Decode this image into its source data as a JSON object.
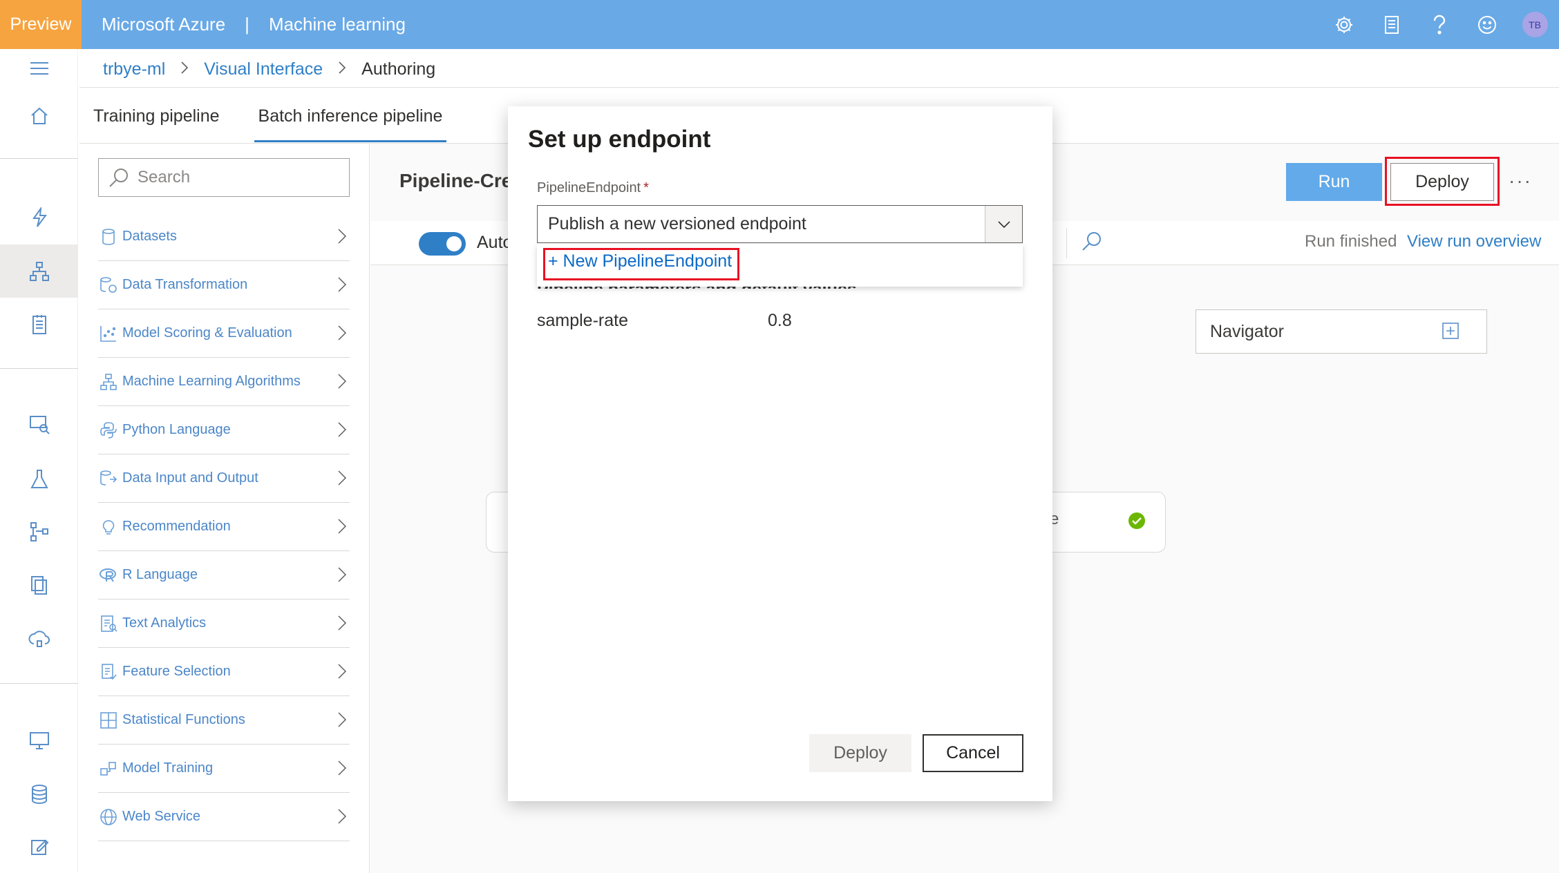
{
  "topbar": {
    "preview": "Preview",
    "product": "Microsoft Azure",
    "separator": "|",
    "service": "Machine learning",
    "avatar_initials": "TB",
    "icons": [
      "gear-icon",
      "notebook-icon",
      "help-icon",
      "smiley-icon"
    ],
    "colors": {
      "bar": "#69a9e6",
      "preview_badge": "#f6a440"
    }
  },
  "breadcrumb": {
    "items": [
      "trbye-ml",
      "Visual Interface",
      "Authoring"
    ]
  },
  "tabs": [
    {
      "label": "Training pipeline"
    },
    {
      "label": "Batch inference pipeline",
      "active": true
    }
  ],
  "palette": {
    "search_placeholder": "Search",
    "items": [
      {
        "label": "Datasets",
        "icon": "cylinder-icon"
      },
      {
        "label": "Data Transformation",
        "icon": "data-transform-icon"
      },
      {
        "label": "Model Scoring & Evaluation",
        "icon": "scatter-icon"
      },
      {
        "label": "Machine Learning Algorithms",
        "icon": "tree-icon"
      },
      {
        "label": "Python Language",
        "icon": "python-icon"
      },
      {
        "label": "Data Input and Output",
        "icon": "data-io-icon"
      },
      {
        "label": "Recommendation",
        "icon": "lightbulb-icon"
      },
      {
        "label": "R Language",
        "icon": "r-icon"
      },
      {
        "label": "Text Analytics",
        "icon": "text-analytics-icon"
      },
      {
        "label": "Feature Selection",
        "icon": "feature-select-icon"
      },
      {
        "label": "Statistical Functions",
        "icon": "grid-icon"
      },
      {
        "label": "Model Training",
        "icon": "model-training-icon"
      },
      {
        "label": "Web Service",
        "icon": "globe-icon"
      }
    ]
  },
  "pipeline": {
    "title": "Pipeline-Cre",
    "run_label": "Run",
    "deploy_label": "Deploy",
    "more_label": "···",
    "autosave_label": "Auto",
    "autosave_on": true,
    "run_status": "Run finished",
    "run_link": "View run overview",
    "navigator_label": "Navigator",
    "node_partial_text": "e"
  },
  "dialog": {
    "title": "Set up endpoint",
    "endpoint_label": "PipelineEndpoint",
    "required_mark": "*",
    "selected_value": "Publish a new versioned endpoint",
    "dropdown_option": "+ New PipelineEndpoint",
    "params_title": "Pipeline parameters and default values",
    "params": [
      {
        "name": "sample-rate",
        "value": "0.8"
      }
    ],
    "deploy_label": "Deploy",
    "cancel_label": "Cancel"
  },
  "highlight_color": "#e81123"
}
